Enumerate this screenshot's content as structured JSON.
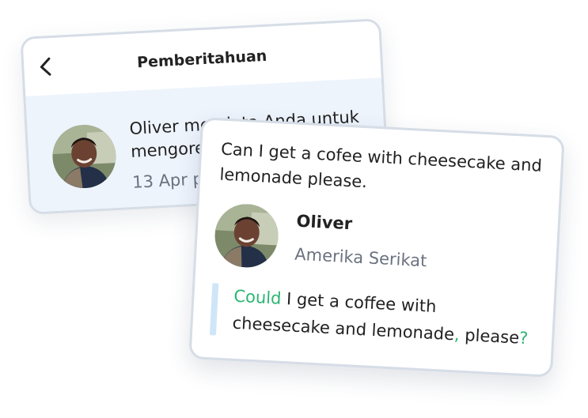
{
  "notification": {
    "title": "Pemberitahuan",
    "message_line1": "Oliver meminta Anda untuk",
    "message_line2": "mengoreksi",
    "date": "13 Apr p"
  },
  "chat": {
    "original_text": "Can I get a cofee with cheesecake and lemonade please.",
    "user_name": "Oliver",
    "user_country": "Amerika Serikat",
    "corrected": {
      "seg1": "Could",
      "seg2": " I get a cof",
      "seg3": "f",
      "seg4": "ee with",
      "seg5": "cheesecake and lemonade",
      "seg6": ",",
      "seg7": " please",
      "seg8": "?"
    }
  },
  "colors": {
    "correction_highlight": "#2bb673",
    "notification_bg": "#eef4fc",
    "card_border": "#d6dde6",
    "quote_bar": "#cfe6f8"
  },
  "icons": {
    "back": "chevron-left-icon",
    "avatar": "user-avatar"
  }
}
